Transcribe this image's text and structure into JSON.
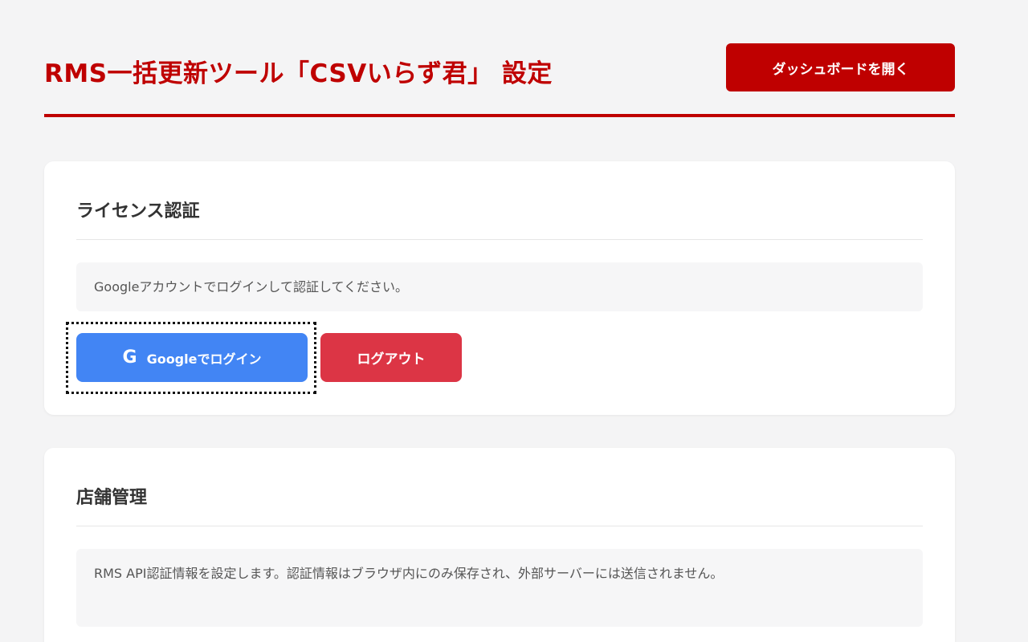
{
  "header": {
    "title": "RMS一括更新ツール「CSVいらず君」 設定",
    "dashboard_button_label": "ダッシュボードを開く"
  },
  "license_section": {
    "title": "ライセンス認証",
    "info_text": "Googleアカウントでログインして認証してください。",
    "google_icon": "G",
    "google_login_label": "Googleでログイン",
    "logout_label": "ログアウト"
  },
  "store_section": {
    "title": "店舗管理",
    "info_text": "RMS API認証情報を設定します。認証情報はブラウザ内にのみ保存され、外部サーバーには送信されません。"
  },
  "colors": {
    "brand_red": "#bf0000",
    "google_blue": "#4285f4",
    "logout_red": "#dc3545"
  }
}
